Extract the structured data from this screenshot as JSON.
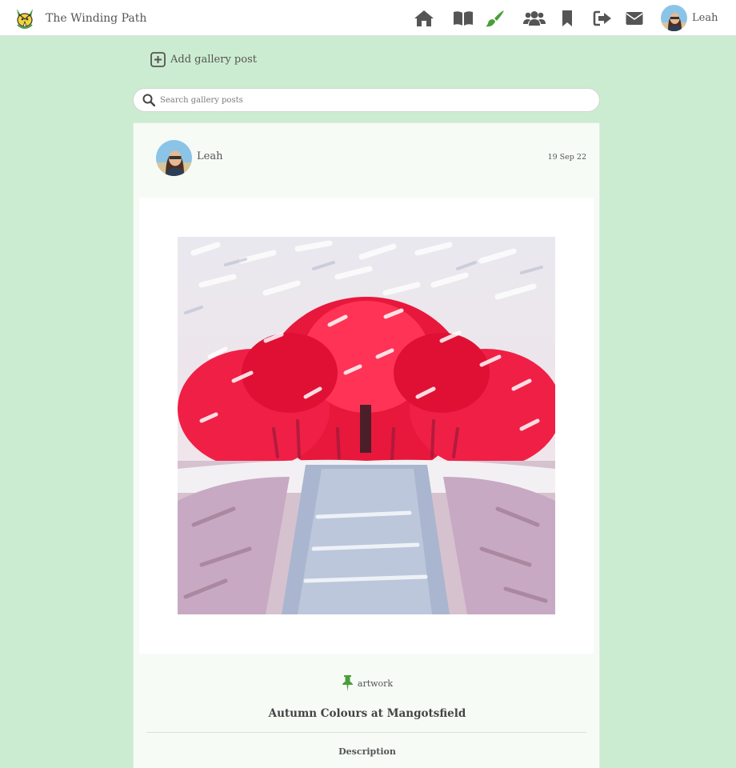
{
  "navbar": {
    "site_title": "The Winding Path",
    "icons": [
      "home-icon",
      "book-icon",
      "paintbrush-icon",
      "users-icon",
      "bookmark-icon",
      "sign-out-icon",
      "envelope-icon"
    ],
    "active_icon": "paintbrush-icon",
    "user_name": "Leah"
  },
  "gallery": {
    "add_post_label": "Add gallery post",
    "search_placeholder": "Search gallery posts"
  },
  "post": {
    "author": "Leah",
    "date": "19 Sep 22",
    "tag": "artwork",
    "title": "Autumn Colours at Mangotsfield",
    "description_heading": "Description"
  },
  "colors": {
    "background": "#cbecd0",
    "accent_green": "#4a9e3a",
    "icon_grey": "#555555"
  }
}
